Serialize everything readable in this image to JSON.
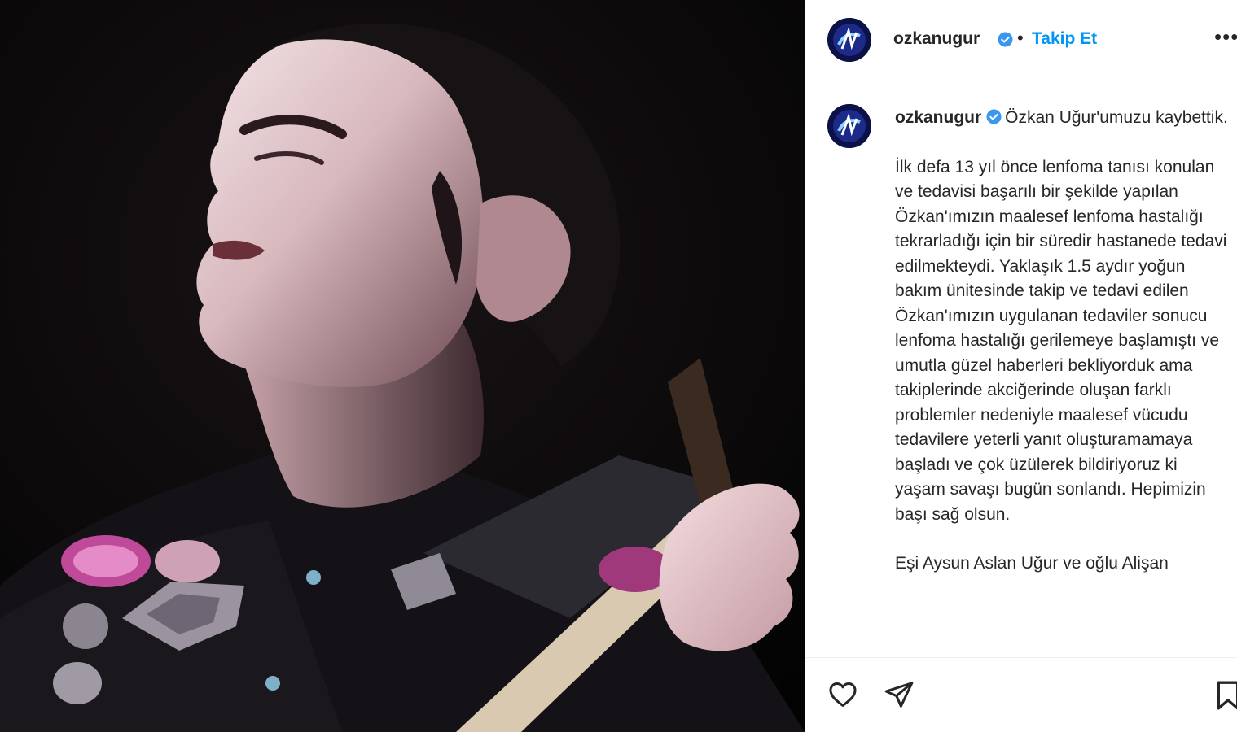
{
  "post": {
    "image_alt": "",
    "account": {
      "username": "ozkanugur",
      "verified": true,
      "follow_label": "Takip Et",
      "separator": "•",
      "more_label": "•••"
    },
    "caption": {
      "username": "ozkanugur",
      "first_line": "Özkan Uğur'umuzu kaybettik.",
      "paragraph_2": "İlk defa 13 yıl önce lenfoma tanısı konulan ve tedavisi başarılı bir şekilde yapılan Özkan'ımızın maalesef lenfoma hastalığı tekrarladığı için bir süredir hastanede tedavi edilmekteydi. Yaklaşık 1.5 aydır yoğun bakım ünitesinde takip ve tedavi edilen Özkan'ımızın uygulanan tedaviler sonucu lenfoma hastalığı gerilemeye başlamıştı ve umutla güzel haberleri bekliyorduk ama takiplerinde akciğerinde oluşan farklı problemler nedeniyle maalesef vücudu tedavilere yeterli yanıt oluşturamamaya başladı ve çok üzülerek bildiriyoruz ki yaşam savaşı bugün sonlandı. Hepimizin başı sağ olsun.",
      "paragraph_3": "Eşi Aysun Aslan Uğur ve oğlu Alişan"
    },
    "actions": {
      "like_icon": "heart-outline-icon",
      "share_icon": "paper-plane-icon",
      "save_icon": "bookmark-icon"
    },
    "colors": {
      "link": "#0095f6",
      "verified": "#3897f0",
      "text": "#262626"
    }
  }
}
